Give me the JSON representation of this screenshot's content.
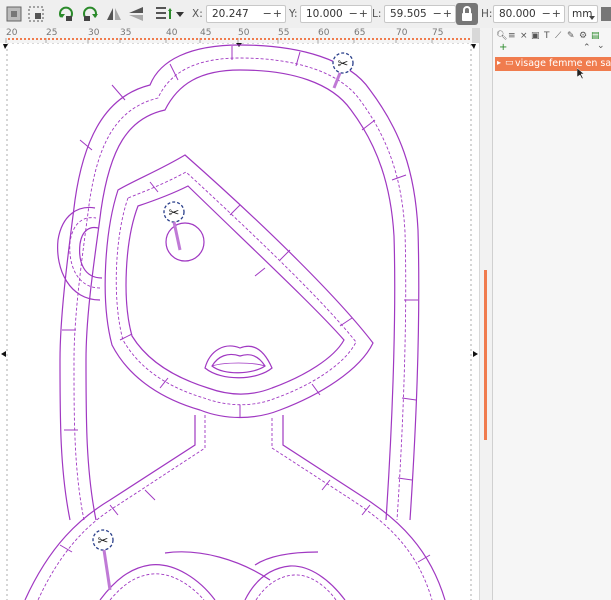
{
  "toolbar": {
    "x_label": "X:",
    "x_value": "20.247",
    "y_label": "Y:",
    "y_value": "10.000",
    "l_label": "L:",
    "l_value": "59.505",
    "h_label": "H:",
    "h_value": "80.000",
    "step_symbols": "−+",
    "unit": "mm",
    "icons": [
      "select-all-icon",
      "select-region-icon",
      "rotate-ccw-icon",
      "rotate-cw-icon",
      "flip-horizontal-icon",
      "flip-vertical-icon",
      "raise-lower-icon",
      "lock-icon"
    ]
  },
  "ruler": {
    "labels": [
      "20",
      "25",
      "30",
      "35",
      "40",
      "45",
      "50",
      "55",
      "60",
      "65",
      "70",
      "75"
    ]
  },
  "layers_panel": {
    "tools": [
      "search-icon",
      "layers-icon",
      "close-icon",
      "new-layer-icon",
      "text-icon",
      "path-icon",
      "transform-icon",
      "settings-icon",
      "image-icon"
    ],
    "add_symbol": "+",
    "layer_name": "visage femme en satin"
  },
  "colors": {
    "path": "#a038c2",
    "accent": "#f07c4e",
    "scissor_ring": "#2a3f8a",
    "ruler_accent": "#f07c4e"
  }
}
